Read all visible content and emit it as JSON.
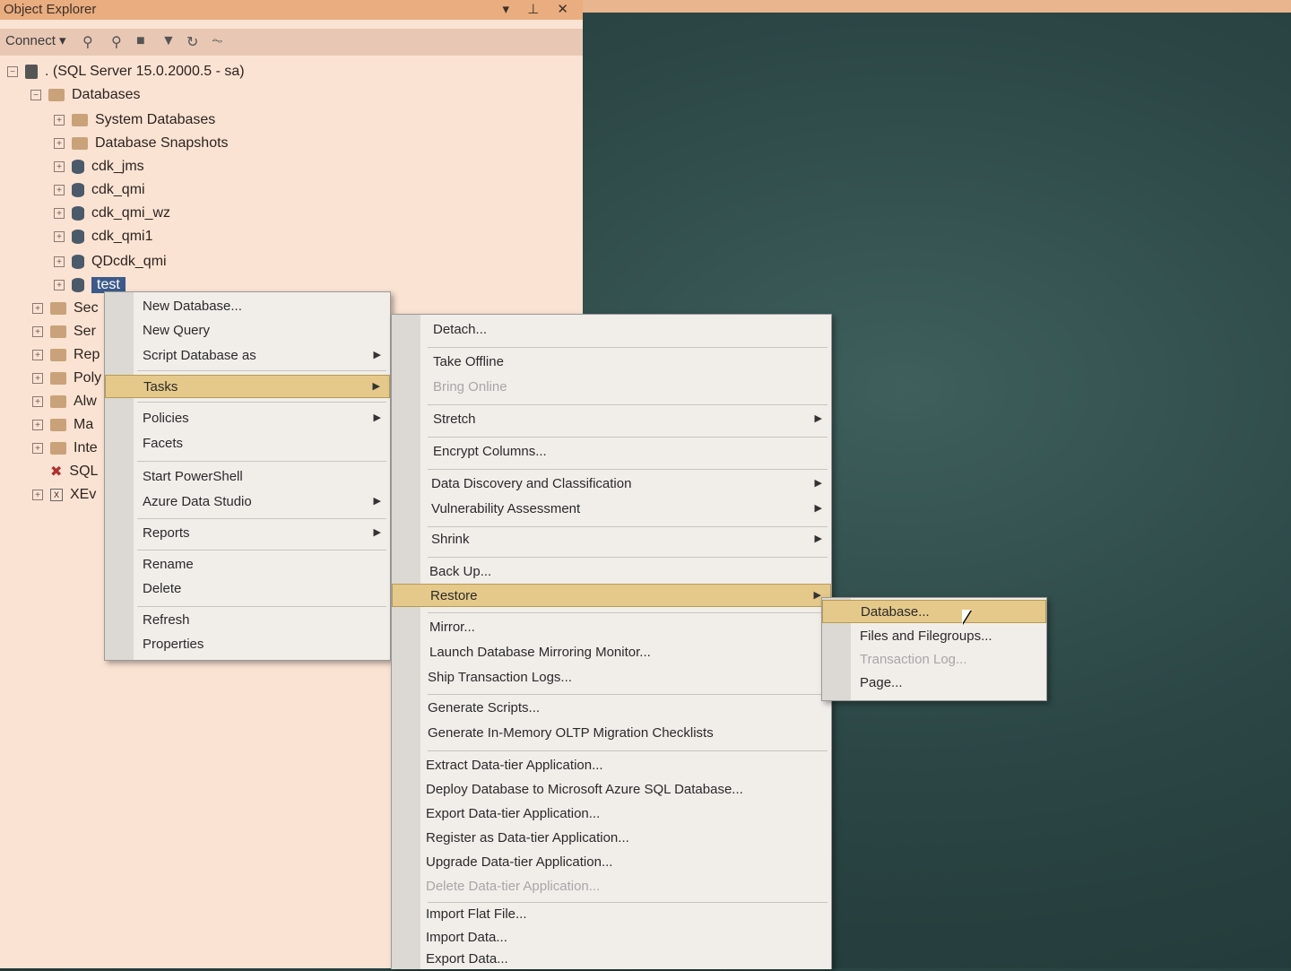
{
  "panel": {
    "title": "Object Explorer",
    "title_buttons": "▾ ⊥ ✕",
    "connect_label": "Connect ▾",
    "server": ". (SQL Server 15.0.2000.5 - sa)",
    "databases_label": "Databases",
    "db_items": [
      "System Databases",
      "Database Snapshots",
      "cdk_jms",
      "cdk_qmi",
      "cdk_qmi_wz",
      "cdk_qmi1",
      "QDcdk_qmi",
      "test"
    ],
    "other_nodes": [
      "Sec",
      "Ser",
      "Rep",
      "Poly",
      "Alw",
      "Ma",
      "Inte",
      "SQL",
      "XEv"
    ]
  },
  "context_menu": {
    "items": [
      "New Database...",
      "New Query",
      "Script Database as",
      "Tasks",
      "Policies",
      "Facets",
      "Start PowerShell",
      "Azure Data Studio",
      "Reports",
      "Rename",
      "Delete",
      "Refresh",
      "Properties"
    ]
  },
  "tasks_menu": {
    "items": [
      "Detach...",
      "Take Offline",
      "Bring Online",
      "Stretch",
      "Encrypt Columns...",
      "Data Discovery and Classification",
      "Vulnerability Assessment",
      "Shrink",
      "Back Up...",
      "Restore",
      "Mirror...",
      "Launch Database Mirroring Monitor...",
      "Ship Transaction Logs...",
      "Generate Scripts...",
      "Generate In-Memory OLTP Migration Checklists",
      "Extract Data-tier Application...",
      "Deploy Database to Microsoft Azure SQL Database...",
      "Export Data-tier Application...",
      "Register as Data-tier Application...",
      "Upgrade Data-tier Application...",
      "Delete Data-tier Application...",
      "Import Flat File...",
      "Import Data...",
      "Export Data..."
    ]
  },
  "restore_menu": {
    "items": [
      "Database...",
      "Files and Filegroups...",
      "Transaction Log...",
      "Page..."
    ]
  },
  "colors": {
    "highlight": "#e5c98a",
    "selection": "#3c5a8a",
    "panel_bg": "#fbe3d3"
  }
}
